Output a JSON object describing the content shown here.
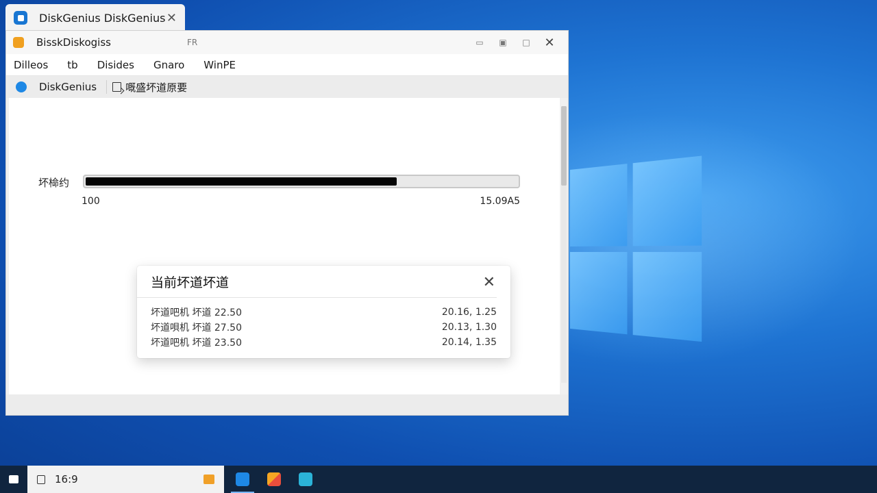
{
  "tab": {
    "title": "DiskGenius DiskGenius"
  },
  "window": {
    "title": "BisskDiskogiss",
    "subtitle": "FR"
  },
  "menu": [
    "Dilleos",
    "tb",
    "Disides",
    "Gnaro",
    "WinPE"
  ],
  "toolbar": {
    "app_name": "DiskGenius",
    "action_label": "嘅盛坏道原要"
  },
  "scan": {
    "label": "坏椧约",
    "progress_fraction": 0.72,
    "left_value": "100",
    "right_value": "15.09A5"
  },
  "dialog": {
    "title": "当前坏道坏道",
    "rows": [
      {
        "text": "坏道吧机 坏道 22.50",
        "value": "20.16,   1.25"
      },
      {
        "text": "坏道唄机 坏道 27.50",
        "value": "20.13,   1.30"
      },
      {
        "text": "坏道吧机 坏道 23.50",
        "value": "20.14,   1.35"
      }
    ]
  },
  "taskbar": {
    "search_text": "16:9",
    "apps": [
      "diskgenius-app",
      "office-app",
      "store-app"
    ]
  },
  "colors": {
    "accent": "#1976d2",
    "progress_fill": "#050505",
    "taskbar": "#10253f"
  }
}
